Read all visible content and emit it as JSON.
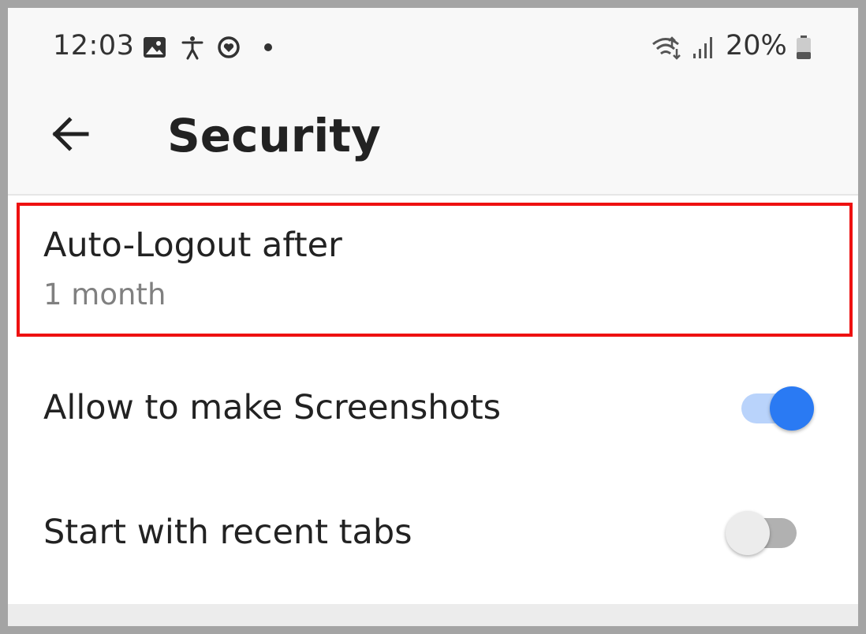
{
  "status_bar": {
    "time": "12:03",
    "battery_percent": "20%",
    "icons": [
      "image-icon",
      "accessibility-icon",
      "heart-circle-icon",
      "dot-icon",
      "wifi-icon",
      "signal-icon",
      "battery-icon"
    ]
  },
  "toolbar": {
    "title": "Security",
    "back_icon": "arrow-back-icon"
  },
  "settings": {
    "auto_logout": {
      "title": "Auto-Logout after",
      "value": "1 month"
    },
    "screenshots": {
      "title": "Allow to make Screenshots",
      "enabled": true
    },
    "recent_tabs": {
      "title": "Start with recent tabs",
      "enabled": false
    }
  },
  "colors": {
    "accent": "#2a7af3",
    "accent_track": "#b9d3fb",
    "off_thumb": "#ececec",
    "off_track": "#b1b1b1",
    "highlight": "#ee1111",
    "bar_background": "#f8f8f8"
  }
}
